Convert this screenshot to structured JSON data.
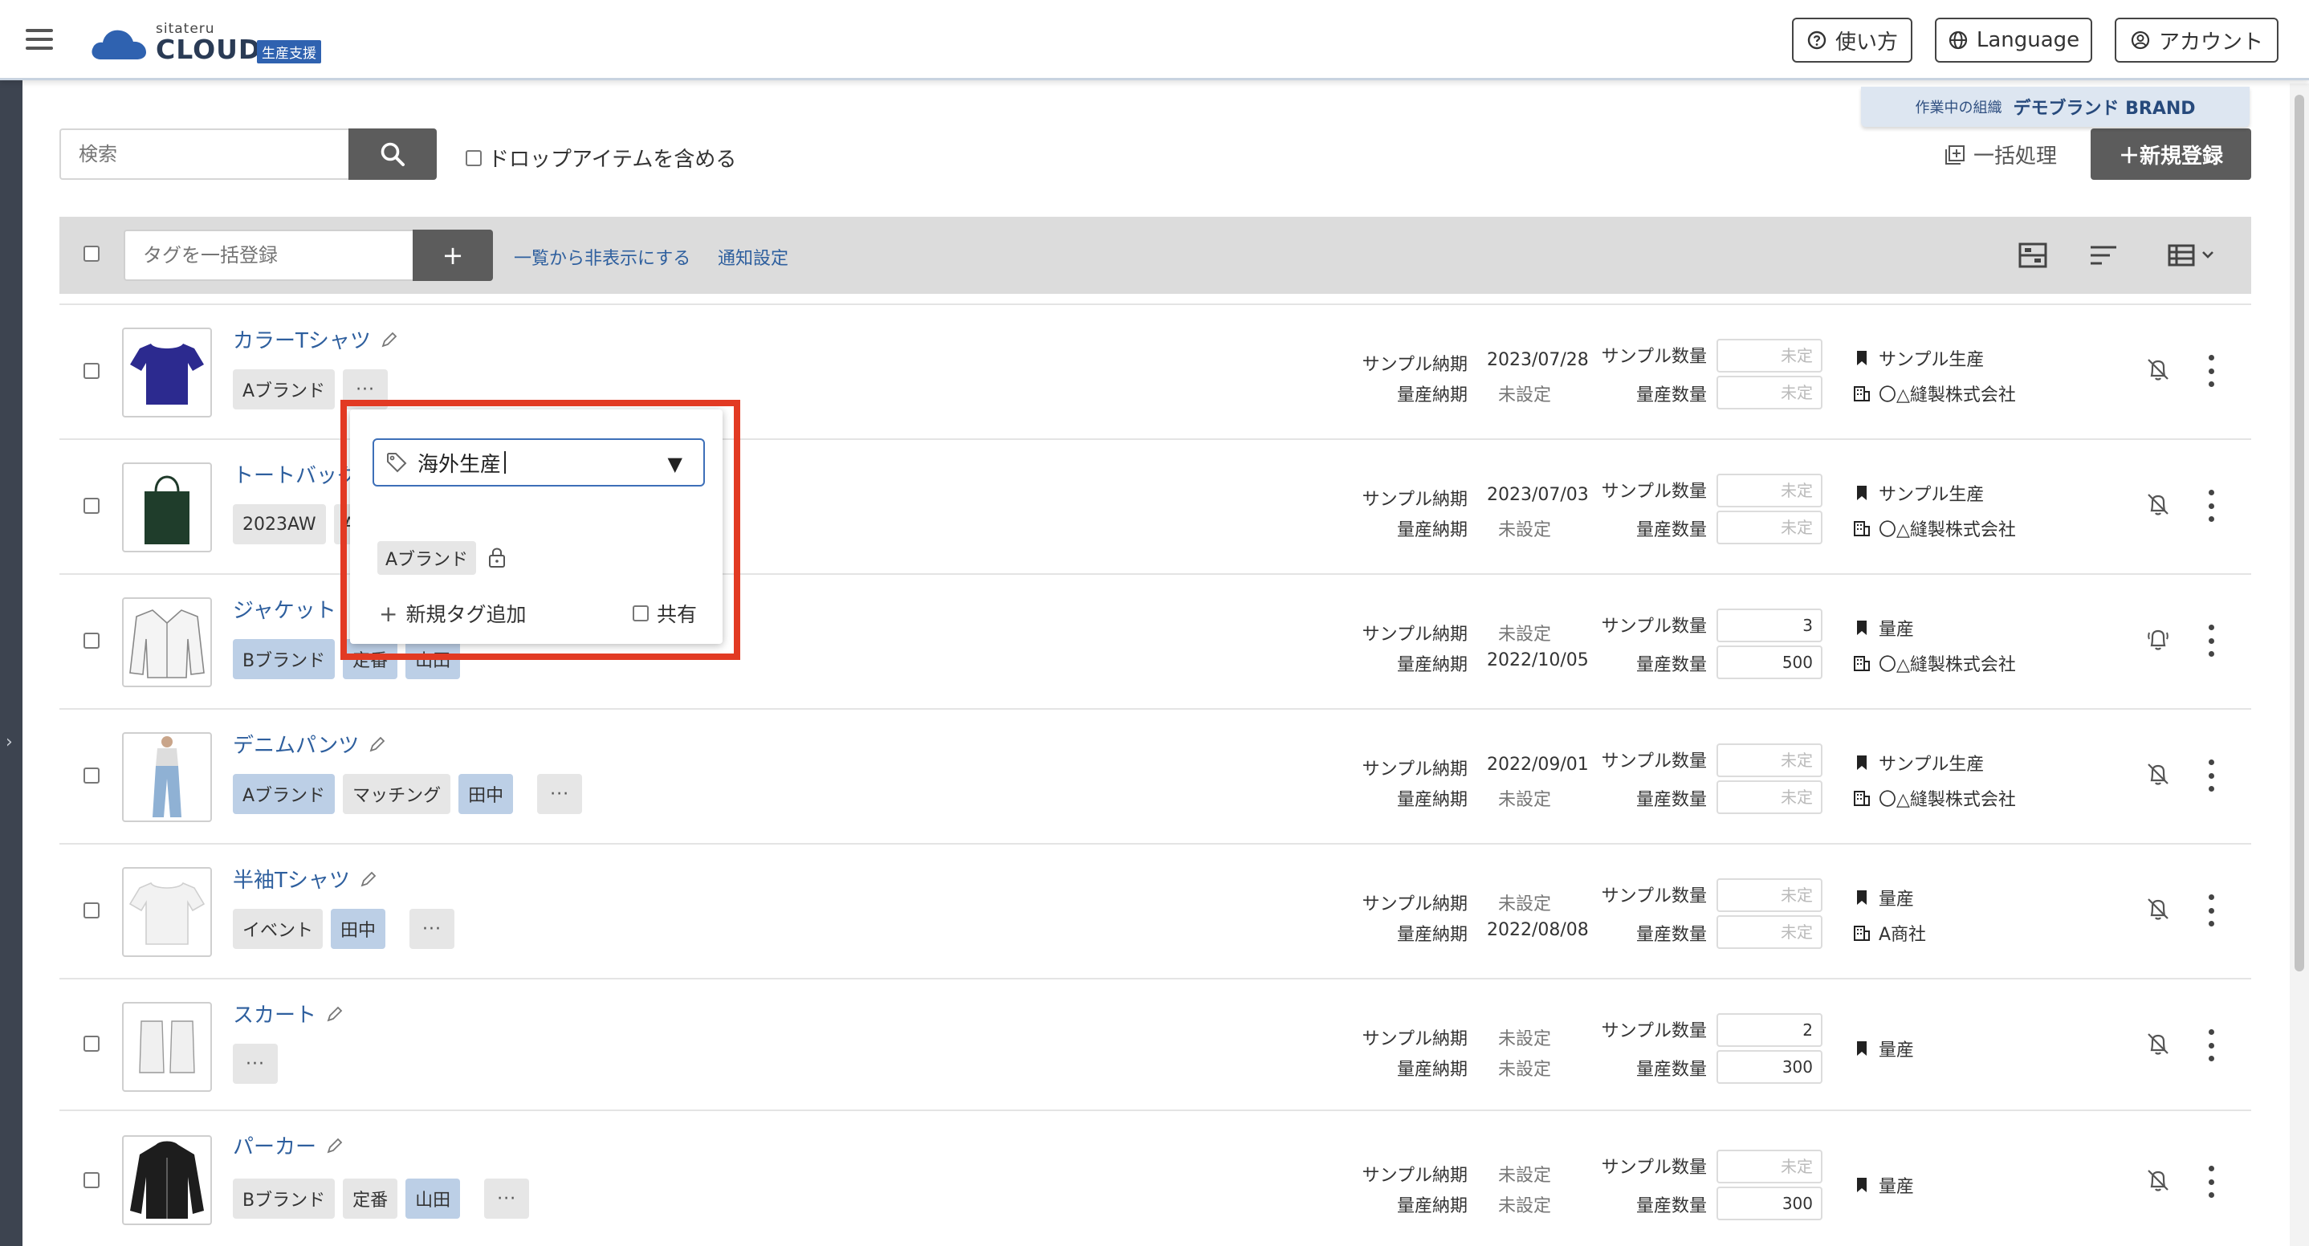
{
  "header": {
    "logo_small": "sitateru",
    "logo_main": "CLOUD",
    "logo_badge": "生産支援",
    "help_label": "使い方",
    "language_label": "Language",
    "account_label": "アカウント"
  },
  "org": {
    "label": "作業中の組織",
    "name": "デモブランド BRAND"
  },
  "search": {
    "placeholder": "検索",
    "drop_items_label": "ドロップアイテムを含める",
    "bulk_label": "一括処理",
    "new_label": "＋新規登録"
  },
  "toolbar": {
    "tag_placeholder": "タグを一括登録",
    "add_label": "+",
    "hide_link": "一覧から非表示にする",
    "notify_link": "通知設定"
  },
  "labels": {
    "sample_due": "サンプル納期",
    "mass_due": "量産納期",
    "sample_qty": "サンプル数量",
    "mass_qty": "量産数量"
  },
  "products": [
    {
      "name": "カラーTシャツ",
      "tags": [
        {
          "text": "Aブランド",
          "blue": false
        }
      ],
      "more": "···",
      "sample_due": "2023/07/28",
      "mass_due": "未設定",
      "sample_qty": "未定",
      "mass_qty": "未定",
      "stage": "サンプル生産",
      "factory": "〇△縫製株式会社",
      "bell": "off"
    },
    {
      "name": "トートバッグ",
      "tags": [
        {
          "text": "2023AW",
          "blue": false
        },
        {
          "text": "A",
          "blue": false
        }
      ],
      "more": "",
      "sample_due": "2023/07/03",
      "mass_due": "未設定",
      "sample_qty": "未定",
      "mass_qty": "未定",
      "stage": "サンプル生産",
      "factory": "〇△縫製株式会社",
      "bell": "off"
    },
    {
      "name": "ジャケット",
      "tags": [
        {
          "text": "Bブランド",
          "blue": true
        },
        {
          "text": "定番",
          "blue": true
        },
        {
          "text": "山田",
          "blue": true
        }
      ],
      "more": "",
      "sample_due": "未設定",
      "mass_due": "2022/10/05",
      "sample_qty": "3",
      "mass_qty": "500",
      "stage": "量産",
      "factory": "〇△縫製株式会社",
      "bell": "on"
    },
    {
      "name": "デニムパンツ",
      "tags": [
        {
          "text": "Aブランド",
          "blue": true
        },
        {
          "text": "マッチング",
          "blue": false
        },
        {
          "text": "田中",
          "blue": true
        }
      ],
      "more": "···",
      "sample_due": "2022/09/01",
      "mass_due": "未設定",
      "sample_qty": "未定",
      "mass_qty": "未定",
      "stage": "サンプル生産",
      "factory": "〇△縫製株式会社",
      "bell": "off"
    },
    {
      "name": "半袖Tシャツ",
      "tags": [
        {
          "text": "イベント",
          "blue": false
        },
        {
          "text": "田中",
          "blue": true
        }
      ],
      "more": "···",
      "sample_due": "未設定",
      "mass_due": "2022/08/08",
      "sample_qty": "未定",
      "mass_qty": "未定",
      "stage": "量産",
      "factory": "A商社",
      "bell": "off"
    },
    {
      "name": "スカート",
      "tags": [],
      "more": "···",
      "sample_due": "未設定",
      "mass_due": "未設定",
      "sample_qty": "2",
      "mass_qty": "300",
      "stage": "量産",
      "factory": "",
      "bell": "off"
    },
    {
      "name": "パーカー",
      "tags": [
        {
          "text": "Bブランド",
          "blue": false
        },
        {
          "text": "定番",
          "blue": false
        },
        {
          "text": "山田",
          "blue": true
        }
      ],
      "more": "···",
      "sample_due": "未設定",
      "mass_due": "未設定",
      "sample_qty": "未定",
      "mass_qty": "300",
      "stage": "量産",
      "factory": "",
      "bell": "off"
    }
  ],
  "popup": {
    "selected_tag": "海外生産",
    "existing_tag": "Aブランド",
    "add_new_label": "新規タグ追加",
    "share_label": "共有"
  },
  "colors": {
    "link": "#2e5f9e",
    "dark_button": "#5c5c5c",
    "highlight": "#e23a23",
    "blue_tag": "#bccfe6"
  }
}
